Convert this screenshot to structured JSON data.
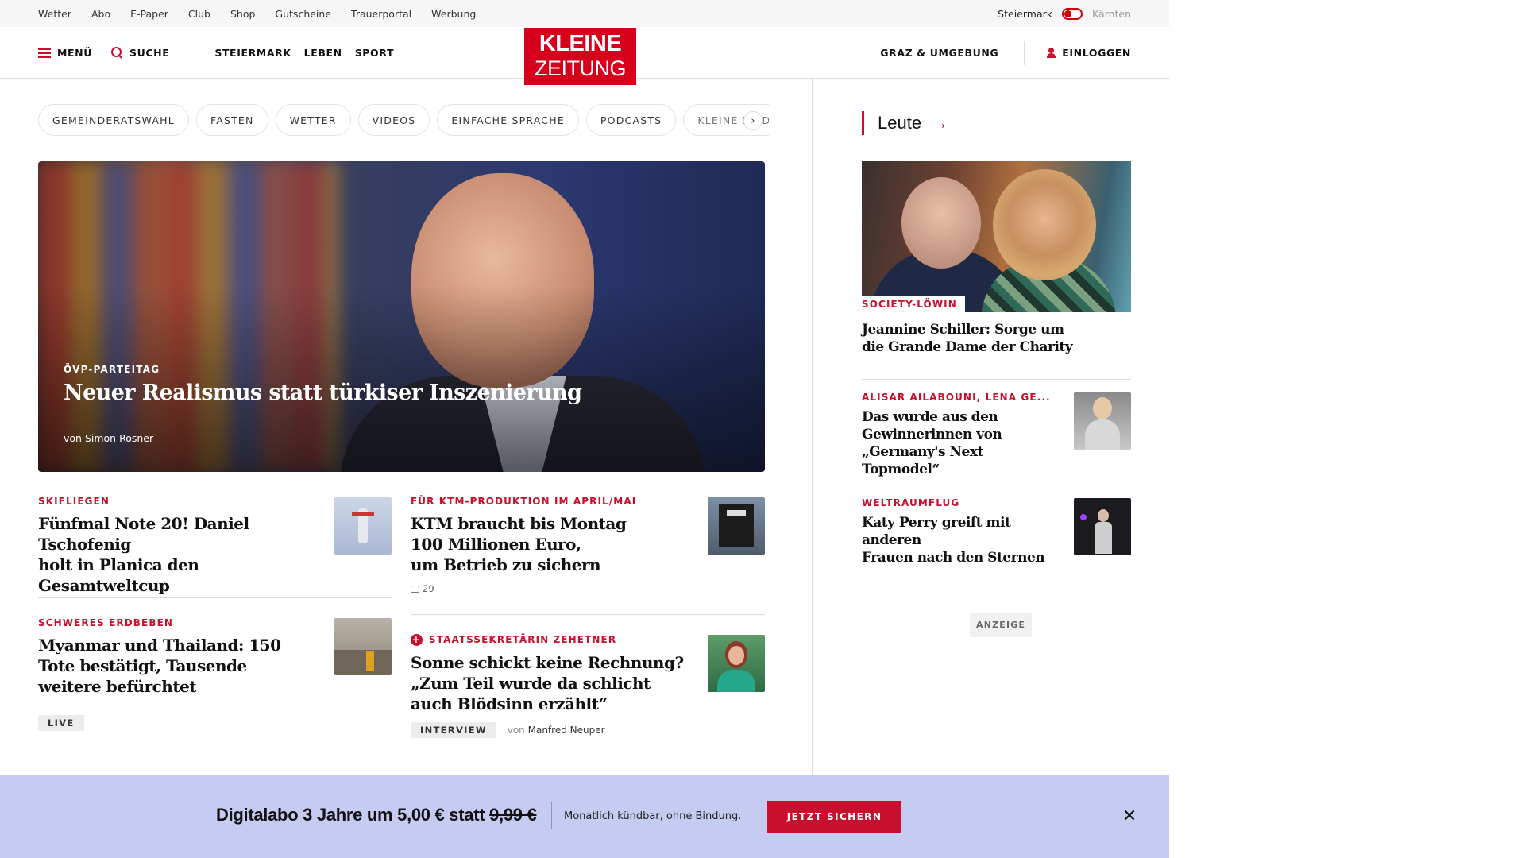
{
  "utility_bar": {
    "links": [
      "Wetter",
      "Abo",
      "E-Paper",
      "Club",
      "Shop",
      "Gutscheine",
      "Trauerportal",
      "Werbung"
    ],
    "region_active": "Steiermark",
    "region_inactive": "Kärnten"
  },
  "main_nav": {
    "menu_label": "MENÜ",
    "search_label": "SUCHE",
    "sections": [
      "STEIERMARK",
      "LEBEN",
      "SPORT"
    ],
    "logo_line1": "KLEINE",
    "logo_line2": "ZEITUNG",
    "local_label": "GRAZ & UMGEBUNG",
    "login_label": "EINLOGGEN"
  },
  "topics": [
    "GEMEINDERATSWAHL",
    "FASTEN",
    "WETTER",
    "VIDEOS",
    "EINFACHE SPRACHE",
    "PODCASTS",
    "KLEINE KINDE"
  ],
  "topics_next_icon": "chevron-right-icon",
  "hero": {
    "kicker": "ÖVP-PARTEITAG",
    "title": "Neuer Realismus statt türkiser Inszenierung",
    "byline": "von Simon Rosner"
  },
  "teasers": [
    {
      "kicker": "SKIFLIEGEN",
      "title_lines": [
        "Fünfmal Note 20! Daniel Tschofenig",
        "holt in Planica den Gesamtweltcup"
      ]
    },
    {
      "kicker": "FÜR KTM-PRODUKTION IM APRIL/MAI",
      "title_lines": [
        "KTM braucht bis Montag",
        "100 Millionen Euro,",
        "um Betrieb zu sichern"
      ],
      "comments": "29"
    },
    {
      "kicker": "SCHWERES ERDBEBEN",
      "title_lines": [
        "Myanmar und Thailand: 150",
        "Tote bestätigt, Tausende",
        "weitere befürchtet"
      ],
      "tag": "LIVE"
    },
    {
      "kicker": "STAATSSEKRETÄRIN ZEHETNER",
      "title_lines": [
        "Sonne schickt keine Rechnung?",
        "„Zum Teil wurde da schlicht",
        "auch Blödsinn erzählt“"
      ],
      "tag": "INTERVIEW",
      "byline_prefix": "von",
      "byline_author": "Manfred Neuper"
    }
  ],
  "sidebar": {
    "section_title": "Leute",
    "lead": {
      "kicker": "SOCIETY-LÖWIN",
      "title_lines": [
        "Jeannine Schiller: Sorge um",
        "die Grande Dame der Charity"
      ]
    },
    "items": [
      {
        "kicker": "ALISAR AILABOUNI, LENA GE...",
        "title_lines": [
          "Das wurde aus den",
          "Gewinnerinnen von",
          "„Germany's Next Topmodel“"
        ]
      },
      {
        "kicker": "WELTRAUMFLUG",
        "title_lines": [
          "Katy Perry greift mit anderen",
          "Frauen nach den Sternen"
        ]
      }
    ],
    "ad_label": "ANZEIGE"
  },
  "promo": {
    "title_main": "Digitalabo 3 Jahre um 5,00 € statt",
    "title_old_price": "9,99 €",
    "subtitle": "Monatlich kündbar, ohne Bindung.",
    "cta": "JETZT SICHERN",
    "close_icon": "close-icon"
  },
  "colors": {
    "brand_red": "#d6001c",
    "accent_red": "#c8102e",
    "promo_bg": "#c6cbf2"
  }
}
